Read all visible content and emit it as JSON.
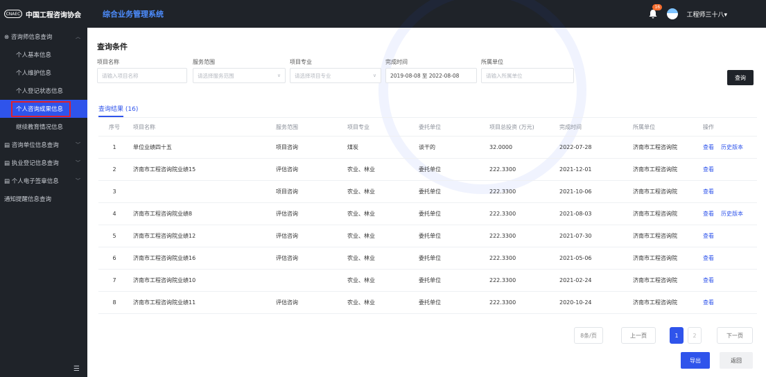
{
  "header": {
    "logo_mark": "CNAEC",
    "logo_text": "中国工程咨询协会",
    "system_title": "综合业务管理系统",
    "notification_count": "16",
    "user_name": "工程师三十八▾"
  },
  "sidebar": {
    "items": [
      {
        "label": "⊗ 咨询师信息查询",
        "level": "group",
        "expanded": true
      },
      {
        "label": "个人基本信息",
        "level": "sub"
      },
      {
        "label": "个人维护信息",
        "level": "sub"
      },
      {
        "label": "个人登记状态信息",
        "level": "sub"
      },
      {
        "label": "个人咨询成果信息",
        "level": "sub",
        "active": true
      },
      {
        "label": "继续教育情况信息",
        "level": "sub"
      },
      {
        "label": "▤ 咨询单位信息查询",
        "level": "group"
      },
      {
        "label": "▤ 执业登记信息查询",
        "level": "group"
      },
      {
        "label": "▤ 个人电子签章信息",
        "level": "group"
      },
      {
        "label": "通知提醒信息查询",
        "level": "group"
      }
    ]
  },
  "filters": {
    "title": "查询条件",
    "project_name": {
      "label": "项目名称",
      "placeholder": "请输入项目名称"
    },
    "service_scope": {
      "label": "服务范围",
      "placeholder": "请选择服务范围"
    },
    "project_major": {
      "label": "项目专业",
      "placeholder": "请选择项目专业"
    },
    "completion_time": {
      "label": "完成时间",
      "value": "2019-08-08 至 2022-08-08"
    },
    "unit": {
      "label": "所属单位",
      "placeholder": "请输入所属单位"
    },
    "query_label": "查询"
  },
  "results": {
    "tab_label": "查询结果 (16)",
    "columns": [
      "序号",
      "项目名称",
      "服务范围",
      "项目专业",
      "委托单位",
      "项目总投资 (万元)",
      "完成时间",
      "所属单位",
      "操作"
    ],
    "rows": [
      {
        "no": "1",
        "name": "单位业绩四十五",
        "scope": "项目咨询",
        "major": "煤炭",
        "client": "谈干的",
        "invest": "32.0000",
        "date": "2022-07-28",
        "unit": "济南市工程咨询院",
        "view": "查看",
        "history": "历史版本"
      },
      {
        "no": "2",
        "name": "济南市工程咨询院业绩15",
        "scope": "评估咨询",
        "major": "农业、林业",
        "client": "委托单位",
        "invest": "222.3300",
        "date": "2021-12-01",
        "unit": "济南市工程咨询院",
        "view": "查看",
        "history": ""
      },
      {
        "no": "3",
        "name": "",
        "scope": "项目咨询",
        "major": "农业、林业",
        "client": "委托单位",
        "invest": "222.3300",
        "date": "2021-10-06",
        "unit": "济南市工程咨询院",
        "view": "查看",
        "history": ""
      },
      {
        "no": "4",
        "name": "济南市工程咨询院业绩8",
        "scope": "评估咨询",
        "major": "农业、林业",
        "client": "委托单位",
        "invest": "222.3300",
        "date": "2021-08-03",
        "unit": "济南市工程咨询院",
        "view": "查看",
        "history": "历史版本"
      },
      {
        "no": "5",
        "name": "济南市工程咨询院业绩12",
        "scope": "评估咨询",
        "major": "农业、林业",
        "client": "委托单位",
        "invest": "222.3300",
        "date": "2021-07-30",
        "unit": "济南市工程咨询院",
        "view": "查看",
        "history": ""
      },
      {
        "no": "6",
        "name": "济南市工程咨询院业绩16",
        "scope": "评估咨询",
        "major": "农业、林业",
        "client": "委托单位",
        "invest": "222.3300",
        "date": "2021-05-06",
        "unit": "济南市工程咨询院",
        "view": "查看",
        "history": ""
      },
      {
        "no": "7",
        "name": "济南市工程咨询院业绩10",
        "scope": "",
        "major": "农业、林业",
        "client": "委托单位",
        "invest": "222.3300",
        "date": "2021-02-24",
        "unit": "济南市工程咨询院",
        "view": "查看",
        "history": ""
      },
      {
        "no": "8",
        "name": "济南市工程咨询院业绩11",
        "scope": "评估咨询",
        "major": "农业、林业",
        "client": "委托单位",
        "invest": "222.3300",
        "date": "2020-10-24",
        "unit": "济南市工程咨询院",
        "view": "查看",
        "history": ""
      }
    ]
  },
  "pagination": {
    "page_size": "8条/页",
    "prev": "上一页",
    "page1": "1",
    "page2": "2",
    "next": "下一页"
  },
  "actions": {
    "export": "导出",
    "back": "返回"
  },
  "colors": {
    "accent": "#2f54eb",
    "dark_bg": "#1f2329",
    "highlight_border": "#e0212b"
  }
}
